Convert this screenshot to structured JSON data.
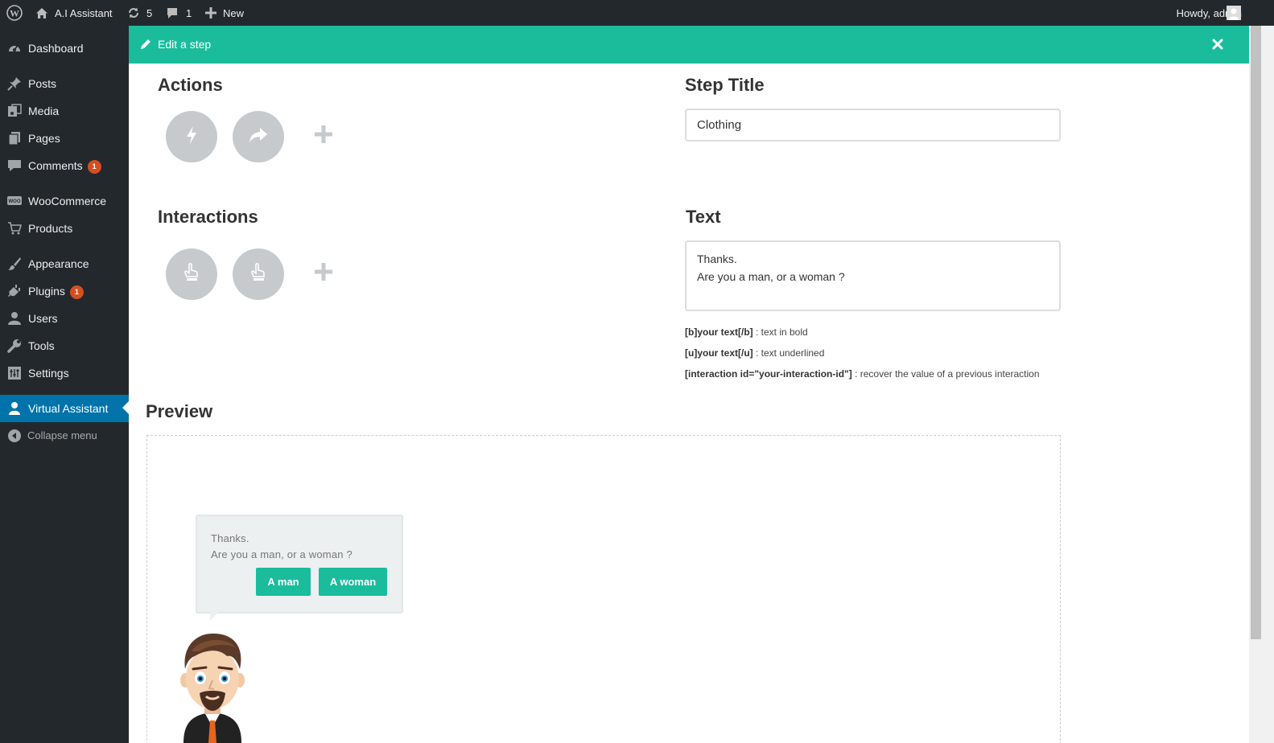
{
  "adminbar": {
    "site_name": "A.I Assistant",
    "updates_count": "5",
    "comments_count": "1",
    "new_label": "New",
    "howdy": "Howdy, admin"
  },
  "menu": {
    "items": [
      {
        "label": "Dashboard",
        "icon": "dashboard-icon"
      },
      {
        "label": "Posts",
        "icon": "pin-icon"
      },
      {
        "label": "Media",
        "icon": "media-icon"
      },
      {
        "label": "Pages",
        "icon": "pages-icon"
      },
      {
        "label": "Comments",
        "icon": "comment-icon",
        "badge": "1"
      },
      {
        "label": "WooCommerce",
        "icon": "woo-icon"
      },
      {
        "label": "Products",
        "icon": "cart-icon"
      },
      {
        "label": "Appearance",
        "icon": "brush-icon"
      },
      {
        "label": "Plugins",
        "icon": "plugin-icon",
        "badge": "1"
      },
      {
        "label": "Users",
        "icon": "user-icon"
      },
      {
        "label": "Tools",
        "icon": "wrench-icon"
      },
      {
        "label": "Settings",
        "icon": "settings-icon"
      },
      {
        "label": "Virtual Assistant",
        "icon": "assistant-icon",
        "current": true
      }
    ],
    "collapse_label": "Collapse menu"
  },
  "modal": {
    "title": "Edit a step",
    "actions_title": "Actions",
    "interactions_title": "Interactions",
    "step_title_label": "Step Title",
    "step_title_value": "Clothing",
    "text_label": "Text",
    "text_lines": [
      "Thanks.",
      "Are you a man, or a woman ?"
    ],
    "help": [
      {
        "code": "[b]your text[/b]",
        "desc": " : text in bold"
      },
      {
        "code": "[u]your text[/u]",
        "desc": " : text underlined"
      },
      {
        "code": "[interaction id=\"your-interaction-id\"]",
        "desc": " : recover the value of a previous interaction"
      }
    ],
    "preview_title": "Preview"
  },
  "preview": {
    "bubble_lines": [
      "Thanks.",
      "Are you a man, or a woman ?"
    ],
    "buttons": [
      "A man",
      "A woman"
    ]
  },
  "colors": {
    "accent": "#1abc9c",
    "admin_bg": "#23282d",
    "current_menu": "#0073aa",
    "badge": "#d54e21"
  }
}
